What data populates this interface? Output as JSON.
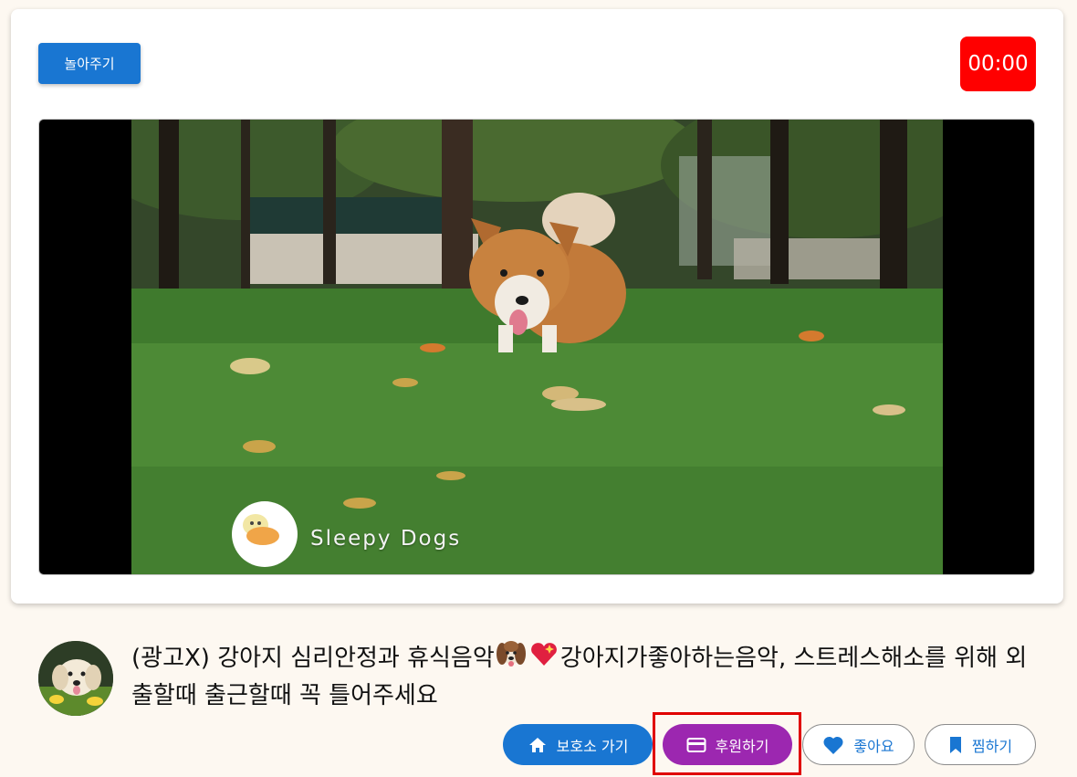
{
  "header": {
    "play_button_label": "놀아주기",
    "timer": "00:00"
  },
  "video": {
    "watermark_text": "Sleepy Dogs"
  },
  "video_info": {
    "title_part1": "(광고X) 강아지 심리안정과 휴식음악",
    "title_part2": "강아지가좋아하는음악, 스트레스해소를 위해 외출할때 출근할때 꼭 틀어주세요"
  },
  "actions": {
    "shelter_label": "보호소 가기",
    "donate_label": "후원하기",
    "like_label": "좋아요",
    "bookmark_label": "찜하기"
  },
  "colors": {
    "background": "#fdf8f1",
    "primary": "#1976d2",
    "donate": "#9c27b0",
    "timer": "#ff0000",
    "highlight": "#e00000"
  },
  "icons": {
    "shelter": "home-icon",
    "donate": "credit-card-icon",
    "like": "heart-icon",
    "bookmark": "bookmark-icon"
  }
}
